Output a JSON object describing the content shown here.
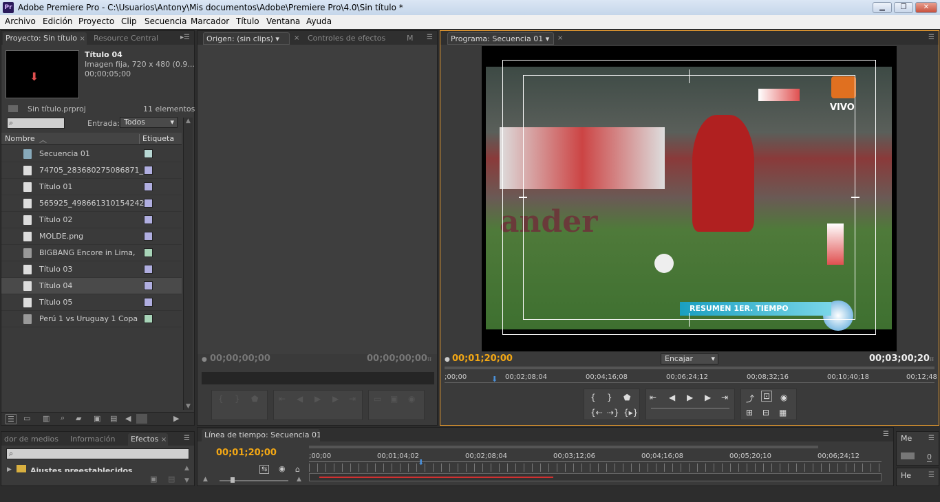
{
  "window": {
    "title": "Adobe Premiere Pro - C:\\Usuarios\\Antony\\Mis documentos\\Adobe\\Premiere Pro\\4.0\\Sin título *",
    "logo": "Pr",
    "buttons": {
      "minimize": "▁",
      "restore": "❐",
      "close": "✕"
    }
  },
  "menu": [
    "Archivo",
    "Edición",
    "Proyecto",
    "Clip",
    "Secuencia",
    "Marcador",
    "Título",
    "Ventana",
    "Ayuda"
  ],
  "project": {
    "tabs": [
      "Proyecto: Sin título",
      "Resource Central"
    ],
    "preview": {
      "title": "Título 04",
      "info": "Imagen fija, 720 x 480 (0.9...",
      "duration": "00;00;05;00"
    },
    "project_file": "Sin título.prproj",
    "item_count": "11 elementos",
    "search_placeholder": "",
    "entrada_label": "Entrada:",
    "entrada_value": "Todos",
    "col_name": "Nombre",
    "col_label": "Etiqueta",
    "items": [
      {
        "name": "Secuencia 01",
        "color": "#b8d8d4",
        "icon": "sequence-icon"
      },
      {
        "name": "74705_283680275086871_",
        "color": "#b0aee0",
        "icon": "file-icon"
      },
      {
        "name": "Título 01",
        "color": "#b0aee0",
        "icon": "file-icon"
      },
      {
        "name": "565925_498661310154242",
        "color": "#b0aee0",
        "icon": "file-icon"
      },
      {
        "name": "Título 02",
        "color": "#b0aee0",
        "icon": "file-icon"
      },
      {
        "name": "MOLDE.png",
        "color": "#b0aee0",
        "icon": "file-icon"
      },
      {
        "name": "BIGBANG   Encore in Lima,",
        "color": "#a8d4b8",
        "icon": "audio-file-icon"
      },
      {
        "name": "Título 03",
        "color": "#b0aee0",
        "icon": "file-icon"
      },
      {
        "name": "Título 04",
        "color": "#b0aee0",
        "icon": "file-icon"
      },
      {
        "name": "Título 05",
        "color": "#b0aee0",
        "icon": "file-icon"
      },
      {
        "name": "Perú 1 vs Uruguay 1 Copa",
        "color": "#a8d4b8",
        "icon": "audio-file-icon"
      }
    ]
  },
  "source": {
    "tabs": [
      "Origen: (sin clips)",
      "Controles de efectos",
      "M"
    ],
    "tc_left": "00;00;00;00",
    "tc_right": "00;00;00;00"
  },
  "program": {
    "tab": "Programa: Secuencia 01",
    "tc_current": "00;01;20;00",
    "fit": "Encajar",
    "tc_duration": "00;03;00;20",
    "ruler": [
      ";00;00",
      "00;02;08;04",
      "00;04;16;08",
      "00;06;24;12",
      "00;08;32;16",
      "00;10;40;18",
      "00;12;48"
    ],
    "video": {
      "vivo": "VIVO",
      "banner": "RESUMEN 1ER. TIEMPO",
      "ad": "ander"
    }
  },
  "effects": {
    "tabs": [
      "dor de medios",
      "Información",
      "Efectos"
    ],
    "search_placeholder": "",
    "first_item": "Ajustes preestablecidos"
  },
  "timeline": {
    "tab": "Línea de tiempo: Secuencia 01",
    "tc": "00;01;20;00",
    "ruler": [
      ";00;00",
      "00;01;04;02",
      "00;02;08;04",
      "00;03;12;06",
      "00;04;16;08",
      "00;05;20;10",
      "00;06;24;12"
    ]
  },
  "right_mini": {
    "tab1": "Me",
    "value": "0",
    "tab2": "He"
  },
  "colors": {
    "timecode": "#f4a814",
    "accent_blue": "#4a90d9",
    "panel": "#3a3a3a",
    "frame": "#f0a030"
  }
}
